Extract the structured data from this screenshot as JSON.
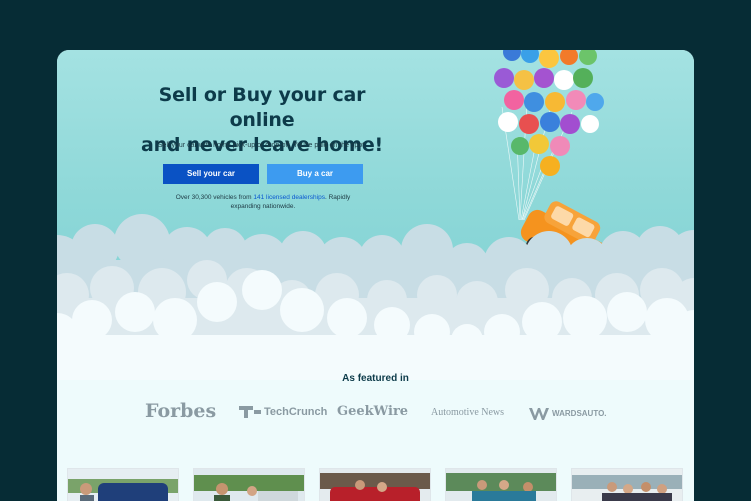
{
  "hero": {
    "title_line1": "Sell or Buy your car online",
    "title_line2": "and never leave home!",
    "subtitle": "Sell your car with home pick-up or drop-off. You're paid on the spot.",
    "sell_button": "Sell your car",
    "buy_button": "Buy a car",
    "stats_prefix": "Over 30,300 vehicles from ",
    "stats_link": "141 licensed dealerships",
    "stats_suffix": ". Rapidly expanding nationwide."
  },
  "featured": {
    "title": "As featured in",
    "logos": [
      "Forbes",
      "TechCrunch",
      "GeekWire",
      "Automotive News",
      "WARDSAUTO."
    ]
  },
  "colors": {
    "background": "#062c35",
    "primary_button": "#0a52c4",
    "secondary_button": "#3d9bf0",
    "car": "#f5931e"
  },
  "thumbnails": [
    "customer-photo-1",
    "customer-photo-2",
    "customer-photo-3",
    "customer-photo-4",
    "customer-photo-5"
  ]
}
